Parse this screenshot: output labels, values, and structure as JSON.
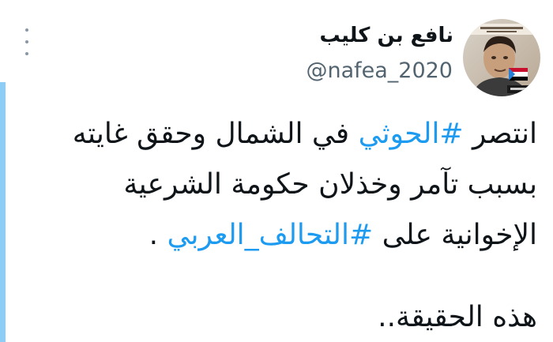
{
  "colors": {
    "accent_bar": "#8ecdf7",
    "link": "#1d9bf0"
  },
  "author": {
    "display_name": "نافع بن كليب",
    "handle": "@nafea_2020"
  },
  "menu_icon": "more-vertical-icon",
  "tweet": {
    "line1_before": "انتصر ",
    "line1_hashtag": "#الحوثي",
    "line1_after": " في الشمال وحقق غايته",
    "line2": "بسبب تآمر وخذلان حكومة الشرعية",
    "line3_before": "الإخوانية على ",
    "line3_hashtag": "#التحالف_العربي",
    "line3_after": " .",
    "line4": "هذه الحقيقة.."
  }
}
